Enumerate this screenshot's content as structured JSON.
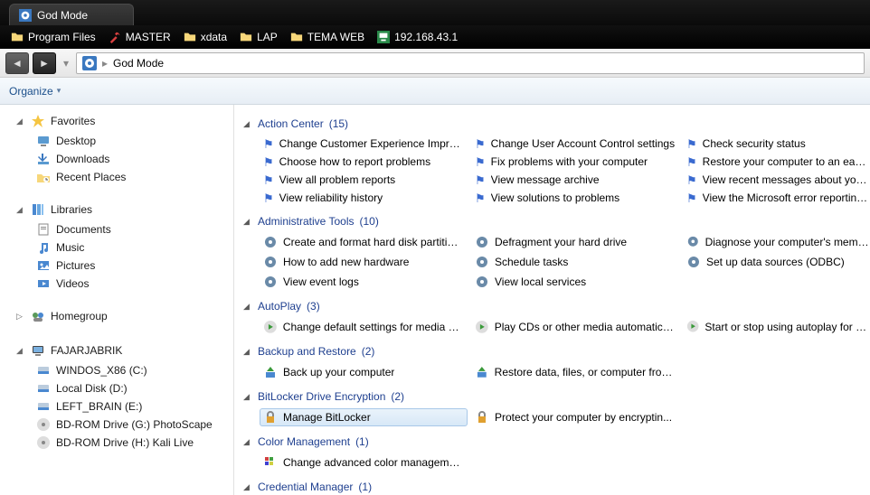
{
  "tab": {
    "title": "God Mode"
  },
  "bookmarks": [
    {
      "icon": "folder",
      "label": "Program Files"
    },
    {
      "icon": "wrench",
      "label": "MASTER"
    },
    {
      "icon": "folder",
      "label": "xdata"
    },
    {
      "icon": "folder",
      "label": "LAP"
    },
    {
      "icon": "folder",
      "label": "TEMA WEB"
    },
    {
      "icon": "net",
      "label": "192.168.43.1"
    }
  ],
  "address": {
    "location": "God Mode",
    "sep": "▸"
  },
  "toolbar": {
    "organize": "Organize"
  },
  "nav": {
    "favorites": {
      "label": "Favorites",
      "items": [
        "Desktop",
        "Downloads",
        "Recent Places"
      ]
    },
    "libraries": {
      "label": "Libraries",
      "items": [
        "Documents",
        "Music",
        "Pictures",
        "Videos"
      ]
    },
    "homegroup": {
      "label": "Homegroup"
    },
    "computer": {
      "label": "FAJARJABRIK",
      "drives": [
        "WINDOS_X86 (C:)",
        "Local Disk (D:)",
        "LEFT_BRAIN (E:)",
        "BD-ROM Drive (G:) PhotoScape",
        "BD-ROM Drive (H:) Kali Live"
      ]
    }
  },
  "categories": [
    {
      "name": "Action Center",
      "count": 15,
      "icon": "flag",
      "items": [
        "Change Customer Experience Impro...",
        "Change User Account Control settings",
        "Check security status",
        "Choose how to report problems",
        "Fix problems with your computer",
        "Restore your computer to an earlier t...",
        "View all problem reports",
        "View message archive",
        "View recent messages about your co...",
        "View reliability history",
        "View solutions to problems",
        "View the Microsoft error reporting pr..."
      ]
    },
    {
      "name": "Administrative Tools",
      "count": 10,
      "icon": "tool",
      "items": [
        "Create and format hard disk partitions",
        "Defragment your hard drive",
        "Diagnose your computer's memory ...",
        "How to add new hardware",
        "Schedule tasks",
        "Set up data sources (ODBC)",
        "View event logs",
        "View local services"
      ]
    },
    {
      "name": "AutoPlay",
      "count": 3,
      "icon": "play",
      "items": [
        "Change default settings for media or...",
        "Play CDs or other media automatically",
        "Start or stop using autoplay for all m..."
      ]
    },
    {
      "name": "Backup and Restore",
      "count": 2,
      "icon": "backup",
      "items": [
        "Back up your computer",
        "Restore data, files, or computer from..."
      ]
    },
    {
      "name": "BitLocker Drive Encryption",
      "count": 2,
      "icon": "lock",
      "selected": 0,
      "items": [
        "Manage BitLocker",
        "Protect your computer by encryptin..."
      ]
    },
    {
      "name": "Color Management",
      "count": 1,
      "icon": "color",
      "items": [
        "Change advanced color manageme..."
      ]
    },
    {
      "name": "Credential Manager",
      "count": 1,
      "icon": "cred",
      "items": []
    }
  ]
}
